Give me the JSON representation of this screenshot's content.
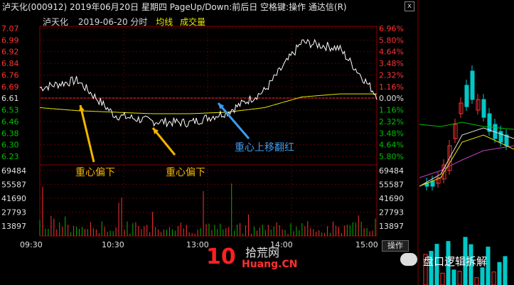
{
  "window": {
    "title": "泸天化(000912)  2019年06月20日 星期四 PageUp/Down:前后日 空格键:操作 通达信(R)",
    "close": "x"
  },
  "subheader": {
    "name": "泸天化",
    "date": "2019-06-20 分时",
    "avg_label": "均线",
    "vol_label": "成交量"
  },
  "price_axis": {
    "left": [
      "7.07",
      "6.99",
      "6.92",
      "6.84",
      "6.76",
      "6.69",
      "6.61",
      "6.53",
      "6.46",
      "6.38",
      "6.30",
      "6.23"
    ],
    "right": [
      "6.96%",
      "5.80%",
      "4.64%",
      "3.48%",
      "2.32%",
      "1.16%",
      "0.00%",
      "1.16%",
      "2.32%",
      "3.48%",
      "4.64%",
      "5.80%"
    ]
  },
  "volume_axis": {
    "left": [
      "69484",
      "55587",
      "41690",
      "27793",
      "13897"
    ],
    "right": [
      "69484",
      "55587",
      "41690",
      "27793",
      "13897"
    ]
  },
  "time_axis": [
    "09:30",
    "10:30",
    "13:00",
    "14:00",
    "15:00"
  ],
  "operate_button": "操作",
  "annotations": [
    {
      "text": "重心偏下",
      "color": "#f2b500"
    },
    {
      "text": "重心偏下",
      "color": "#f2b500"
    },
    {
      "text": "重心上移翻红",
      "color": "#3c9cf0"
    }
  ],
  "watermark": {
    "main": "拾荒网",
    "sub": "Huang.CN",
    "number": "10"
  },
  "brand": "盘口逻辑拆解",
  "colors": {
    "up": "#ff3232",
    "down": "#00c8c8",
    "grid": "#8b0000",
    "price_line": "#ffffff",
    "avg_line": "#e8e800"
  },
  "chart_data": {
    "type": "line",
    "title": "泸天化 2019-06-20 分时",
    "prev_close": 6.61,
    "ylim": [
      6.23,
      7.07
    ],
    "x": [
      "09:30",
      "10:00",
      "10:30",
      "11:00",
      "11:30",
      "13:00",
      "13:30",
      "14:00",
      "14:30",
      "15:00"
    ],
    "series": [
      {
        "name": "price",
        "values": [
          6.68,
          6.73,
          6.5,
          6.46,
          6.45,
          6.52,
          6.66,
          6.98,
          6.94,
          6.63
        ]
      },
      {
        "name": "均线",
        "values": [
          6.55,
          6.53,
          6.52,
          6.51,
          6.51,
          6.52,
          6.55,
          6.62,
          6.64,
          6.64
        ]
      }
    ],
    "volume_max": 69484
  }
}
